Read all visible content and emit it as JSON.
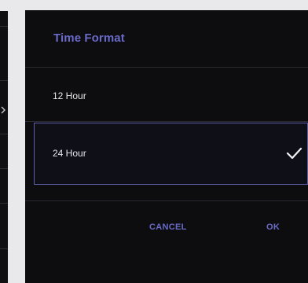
{
  "dialog": {
    "title": "Time Format",
    "options": [
      {
        "label": "12 Hour",
        "selected": false
      },
      {
        "label": "24 Hour",
        "selected": true
      }
    ],
    "cancel_label": "CANCEL",
    "ok_label": "OK"
  },
  "colors": {
    "accent": "#6a6ac9",
    "dialog_bg": "#0d0d10",
    "page_bg": "#e9e9ec",
    "selected_border": "#5e5eaa",
    "text": "#e6e6ea"
  },
  "icons": {
    "selected_indicator": "check-icon",
    "background_row_arrow": "chevron-right-icon"
  }
}
